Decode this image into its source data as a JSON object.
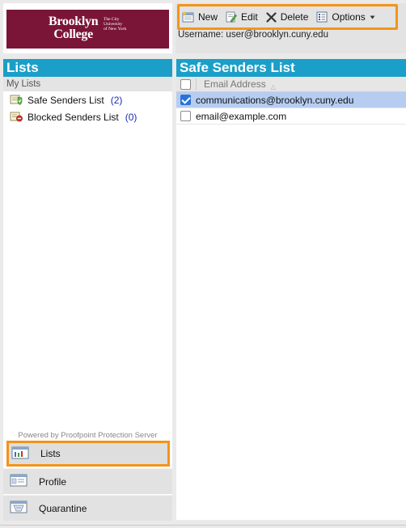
{
  "brand": {
    "name_line1": "Brooklyn",
    "name_line2": "College",
    "sub_line1": "The City",
    "sub_line2": "University",
    "sub_line3": "of New York",
    "color": "#7a1538"
  },
  "toolbar": {
    "new_label": "New",
    "edit_label": "Edit",
    "delete_label": "Delete",
    "options_label": "Options",
    "highlight_color": "#f39419"
  },
  "user": {
    "username_text": "Username:  user@brooklyn.cuny.edu"
  },
  "left": {
    "title": "Lists",
    "section": "My Lists",
    "lists": [
      {
        "label": "Safe Senders List",
        "count": "(2)",
        "icon": "shield-check-icon"
      },
      {
        "label": "Blocked Senders List",
        "count": "(0)",
        "icon": "blocked-icon"
      }
    ],
    "powered_by": "Powered by Proofpoint Protection Server",
    "nav": [
      {
        "label": "Lists",
        "icon": "lists-icon",
        "active": true
      },
      {
        "label": "Profile",
        "icon": "profile-icon",
        "active": false
      },
      {
        "label": "Quarantine",
        "icon": "quarantine-icon",
        "active": false
      }
    ]
  },
  "right": {
    "title": "Safe Senders List",
    "column_header": "Email Address",
    "rows": [
      {
        "email": "communications@brooklyn.cuny.edu",
        "checked": true
      },
      {
        "email": "email@example.com",
        "checked": false
      }
    ]
  },
  "colors": {
    "title_bar": "#1b9fc8",
    "selected_row": "#b6cdf1",
    "link_count": "#1a2bb0"
  }
}
